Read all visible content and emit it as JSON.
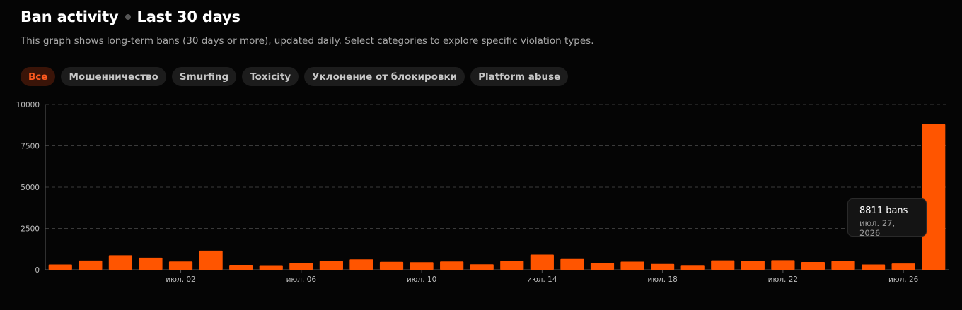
{
  "header": {
    "title": "Ban activity",
    "subtitle": "Last 30 days",
    "description": "This graph shows long-term bans (30 days or more), updated daily. Select categories to explore specific violation types."
  },
  "filters": [
    {
      "label": "Все",
      "active": true
    },
    {
      "label": "Мошенничество",
      "active": false
    },
    {
      "label": "Smurfing",
      "active": false
    },
    {
      "label": "Toxicity",
      "active": false
    },
    {
      "label": "Уклонение от блокировки",
      "active": false
    },
    {
      "label": "Platform abuse",
      "active": false
    }
  ],
  "tooltip": {
    "value": "8811 bans",
    "date": "июл. 27, 2026"
  },
  "colors": {
    "accent": "#ff5500",
    "chip_active_bg": "#3a1408",
    "chip_active_text": "#ff5a1f",
    "chip_bg": "#1c1c1c"
  },
  "chart_data": {
    "type": "bar",
    "ylim": [
      0,
      10000
    ],
    "yticks": [
      0,
      2500,
      5000,
      7500,
      10000
    ],
    "grid": true,
    "x_tick_labels": [
      {
        "index": 4.5,
        "label": "июл. 02"
      },
      {
        "index": 8.5,
        "label": "июл. 06"
      },
      {
        "index": 12.5,
        "label": "июл. 10"
      },
      {
        "index": 16.5,
        "label": "июл. 14"
      },
      {
        "index": 20.5,
        "label": "июл. 18"
      },
      {
        "index": 24.5,
        "label": "июл. 22"
      },
      {
        "index": 28.5,
        "label": "июл. 26"
      }
    ],
    "values": [
      320,
      560,
      880,
      730,
      500,
      1160,
      300,
      280,
      400,
      530,
      630,
      480,
      460,
      500,
      330,
      530,
      920,
      650,
      410,
      490,
      350,
      290,
      570,
      540,
      580,
      470,
      530,
      320,
      380,
      8811
    ]
  }
}
